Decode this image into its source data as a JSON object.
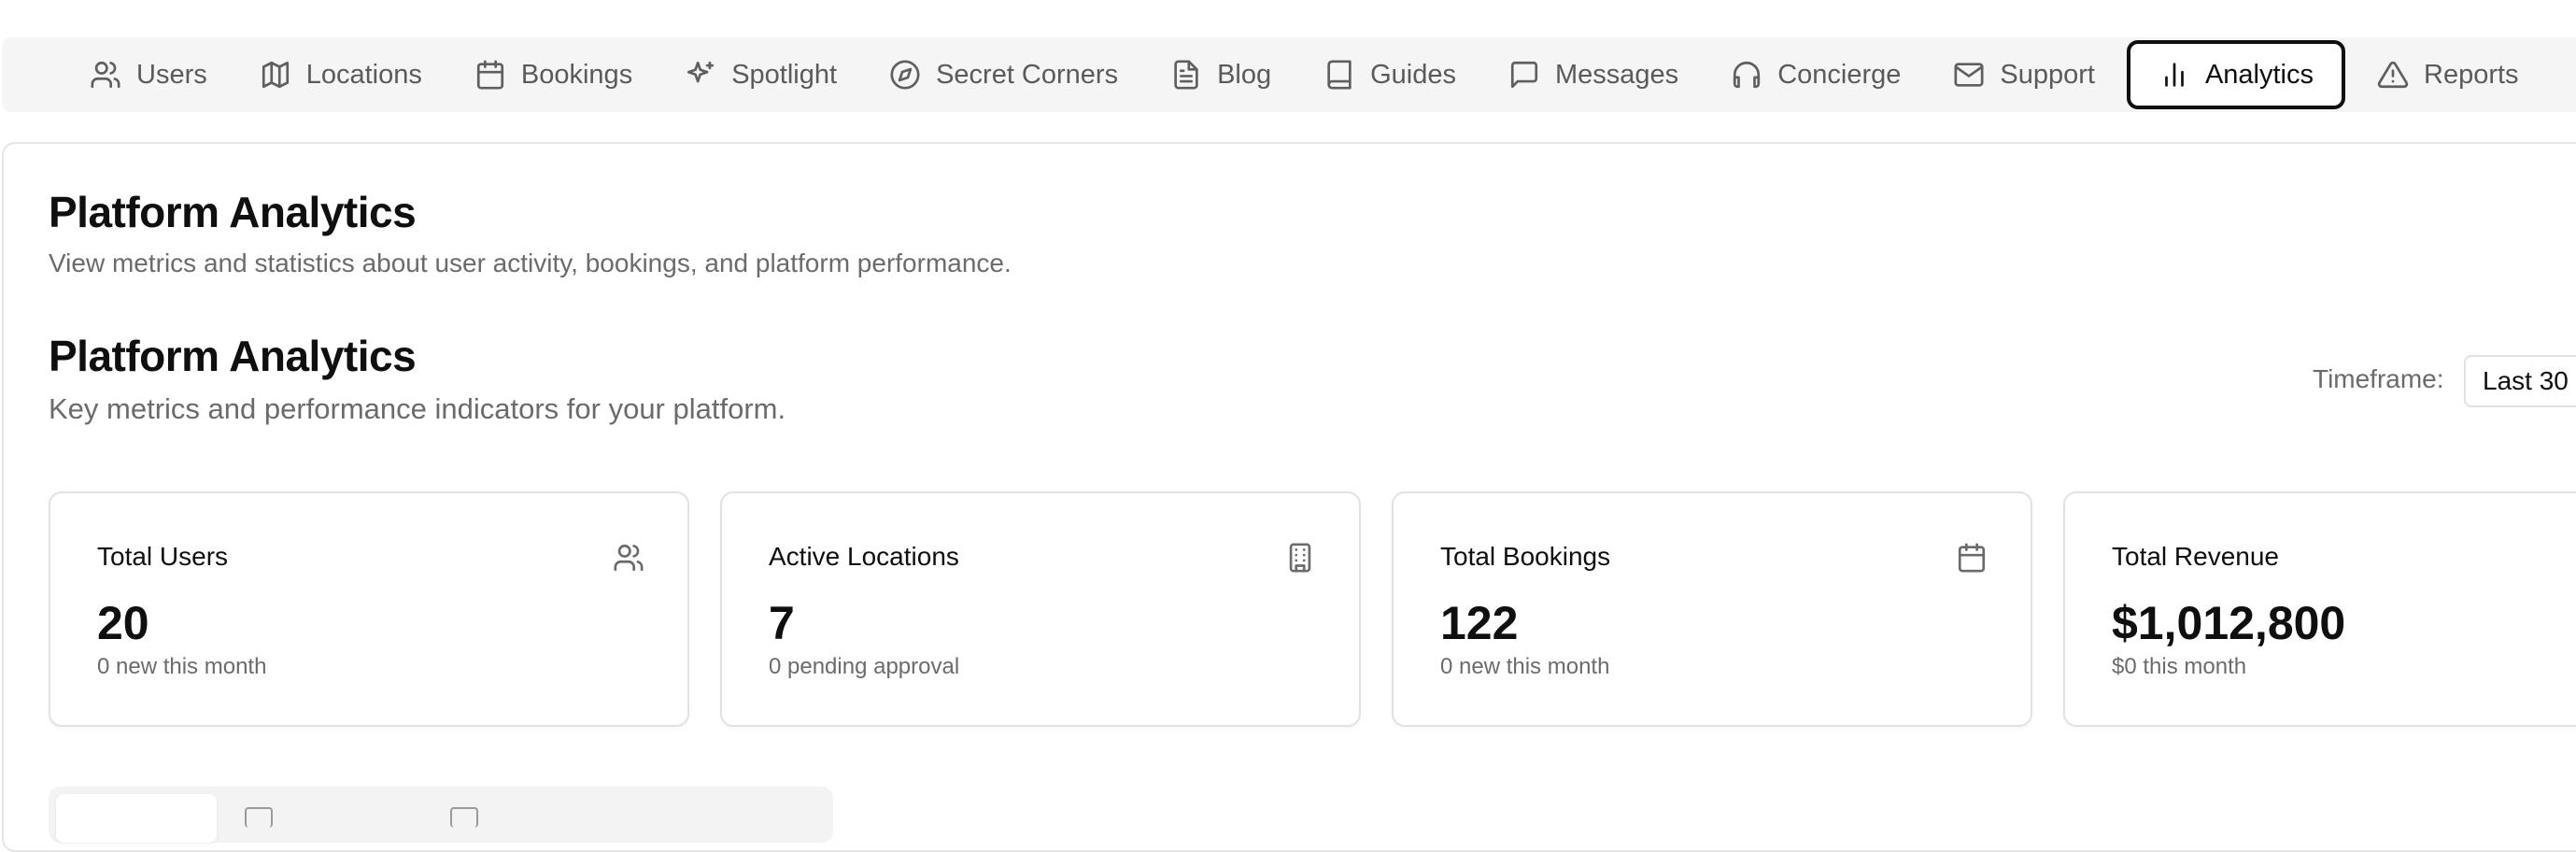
{
  "nav": {
    "items": [
      {
        "label": "Users",
        "icon": "users-icon"
      },
      {
        "label": "Locations",
        "icon": "map-icon"
      },
      {
        "label": "Bookings",
        "icon": "calendar-icon"
      },
      {
        "label": "Spotlight",
        "icon": "sparkles-icon"
      },
      {
        "label": "Secret Corners",
        "icon": "compass-icon"
      },
      {
        "label": "Blog",
        "icon": "file-text-icon"
      },
      {
        "label": "Guides",
        "icon": "book-icon"
      },
      {
        "label": "Messages",
        "icon": "message-square-icon"
      },
      {
        "label": "Concierge",
        "icon": "headphones-icon"
      },
      {
        "label": "Support",
        "icon": "mail-icon"
      },
      {
        "label": "Analytics",
        "icon": "bar-chart-icon",
        "active": true
      },
      {
        "label": "Reports",
        "icon": "alert-triangle-icon"
      }
    ]
  },
  "header": {
    "title": "Platform Analytics",
    "subtitle": "View metrics and statistics about user activity, bookings, and platform performance."
  },
  "analytics": {
    "title": "Platform Analytics",
    "subtitle": "Key metrics and performance indicators for your platform.",
    "timeframe_label": "Timeframe:",
    "timeframe_value": "Last 30"
  },
  "cards": [
    {
      "title": "Total Users",
      "value": "20",
      "note": "0 new this month",
      "icon": "users-icon"
    },
    {
      "title": "Active Locations",
      "value": "7",
      "note": "0 pending approval",
      "icon": "building-icon"
    },
    {
      "title": "Total Bookings",
      "value": "122",
      "note": "0 new this month",
      "icon": "calendar-icon"
    },
    {
      "title": "Total Revenue",
      "value": "$1,012,800",
      "note": "$0 this month",
      "icon": "dollar-icon"
    }
  ]
}
